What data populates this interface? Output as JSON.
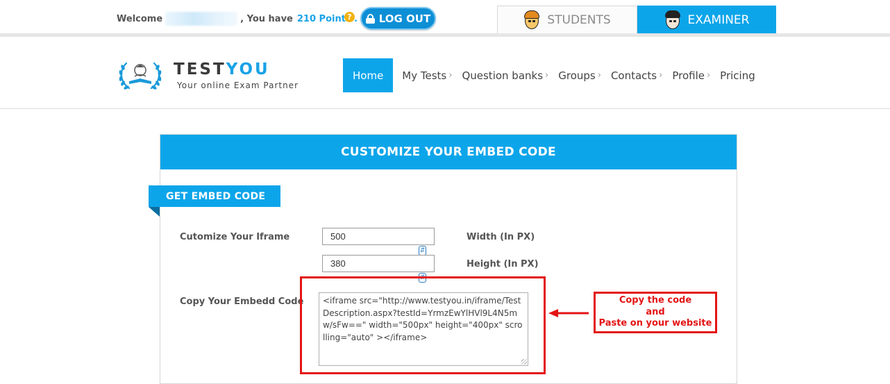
{
  "topbar": {
    "welcome_label": "Welcome",
    "you_have_label": ", You have",
    "points_label": "210 Points .",
    "help_glyph": "?",
    "logout_label": "LOG OUT",
    "role_tabs": [
      {
        "label": "STUDENTS",
        "icon": "student-avatar-icon",
        "active": false
      },
      {
        "label": "EXAMINER",
        "icon": "examiner-avatar-icon",
        "active": true
      }
    ]
  },
  "brand": {
    "name_part1": "TEST",
    "name_part2": "YOU",
    "tagline": "Your online Exam Partner"
  },
  "nav": {
    "items": [
      {
        "label": "Home",
        "active": true,
        "has_chevron": false
      },
      {
        "label": "My Tests",
        "active": false,
        "has_chevron": true
      },
      {
        "label": "Question banks",
        "active": false,
        "has_chevron": true
      },
      {
        "label": "Groups",
        "active": false,
        "has_chevron": true
      },
      {
        "label": "Contacts",
        "active": false,
        "has_chevron": true
      },
      {
        "label": "Profile",
        "active": false,
        "has_chevron": true
      },
      {
        "label": "Pricing",
        "active": false,
        "has_chevron": false
      }
    ],
    "chevron_glyph": "›"
  },
  "panel": {
    "title": "CUSTOMIZE YOUR EMBED CODE",
    "section_label": "GET EMBED CODE",
    "iframe_label": "Cutomize Your Iframe",
    "width_value": "500",
    "width_label": "Width (In PX)",
    "height_value": "380",
    "height_label": "Height (In PX)",
    "embed_label": "Copy Your Embedd Code",
    "embed_code": "<iframe src=\"http://www.testyou.in/iframe/TestDescription.aspx?testId=YrmzEwYlHVl9L4N5mw/sFw==\" width=\"500px\" height=\"400px\" scrolling=\"auto\" ></iframe>"
  },
  "annotation": {
    "line1": "Copy the code",
    "line2": "and",
    "line3": "Paste on your website",
    "color": "#e31414"
  },
  "colors": {
    "accent": "#0da5ea",
    "logout": "#0d8fd6",
    "points": "#1aa3e8"
  }
}
